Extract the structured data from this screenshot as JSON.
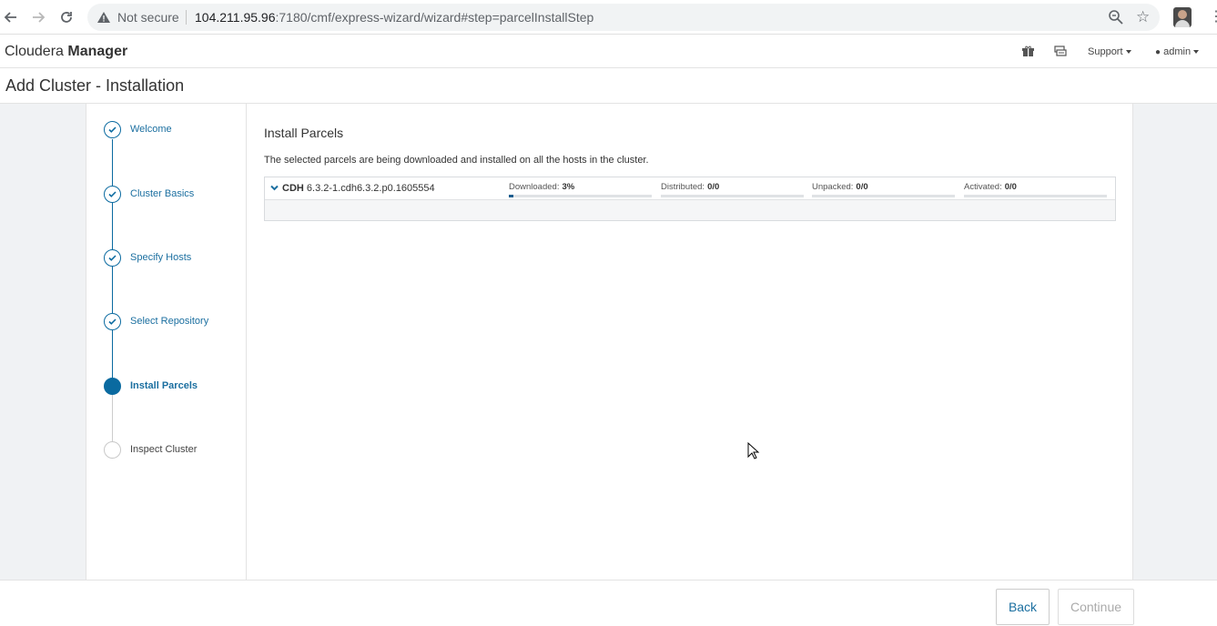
{
  "browser": {
    "security_label": "Not secure",
    "url_host": "104.211.95.96",
    "url_path": ":7180/cmf/express-wizard/wizard#step=parcelInstallStep"
  },
  "header": {
    "brand_light": "Cloudera",
    "brand_bold": "Manager",
    "support_label": "Support",
    "admin_label": "admin"
  },
  "page": {
    "title": "Add Cluster - Installation"
  },
  "steps": [
    {
      "label": "Welcome",
      "state": "done"
    },
    {
      "label": "Cluster Basics",
      "state": "done"
    },
    {
      "label": "Specify Hosts",
      "state": "done"
    },
    {
      "label": "Select Repository",
      "state": "done"
    },
    {
      "label": "Install Parcels",
      "state": "active"
    },
    {
      "label": "Inspect Cluster",
      "state": "pending"
    }
  ],
  "content": {
    "title": "Install Parcels",
    "description": "The selected parcels are being downloaded and installed on all the hosts in the cluster.",
    "parcel": {
      "product": "CDH",
      "version": "6.3.2-1.cdh6.3.2.p0.1605554",
      "stats": [
        {
          "label": "Downloaded:",
          "value": "3%",
          "progress": 0.03
        },
        {
          "label": "Distributed:",
          "value": "0/0",
          "progress": 0
        },
        {
          "label": "Unpacked:",
          "value": "0/0",
          "progress": 0
        },
        {
          "label": "Activated:",
          "value": "0/0",
          "progress": 0
        }
      ]
    }
  },
  "footer": {
    "back_label": "Back",
    "continue_label": "Continue"
  },
  "colors": {
    "accent": "#0a6aa0",
    "progress": "#1b5e8f"
  }
}
